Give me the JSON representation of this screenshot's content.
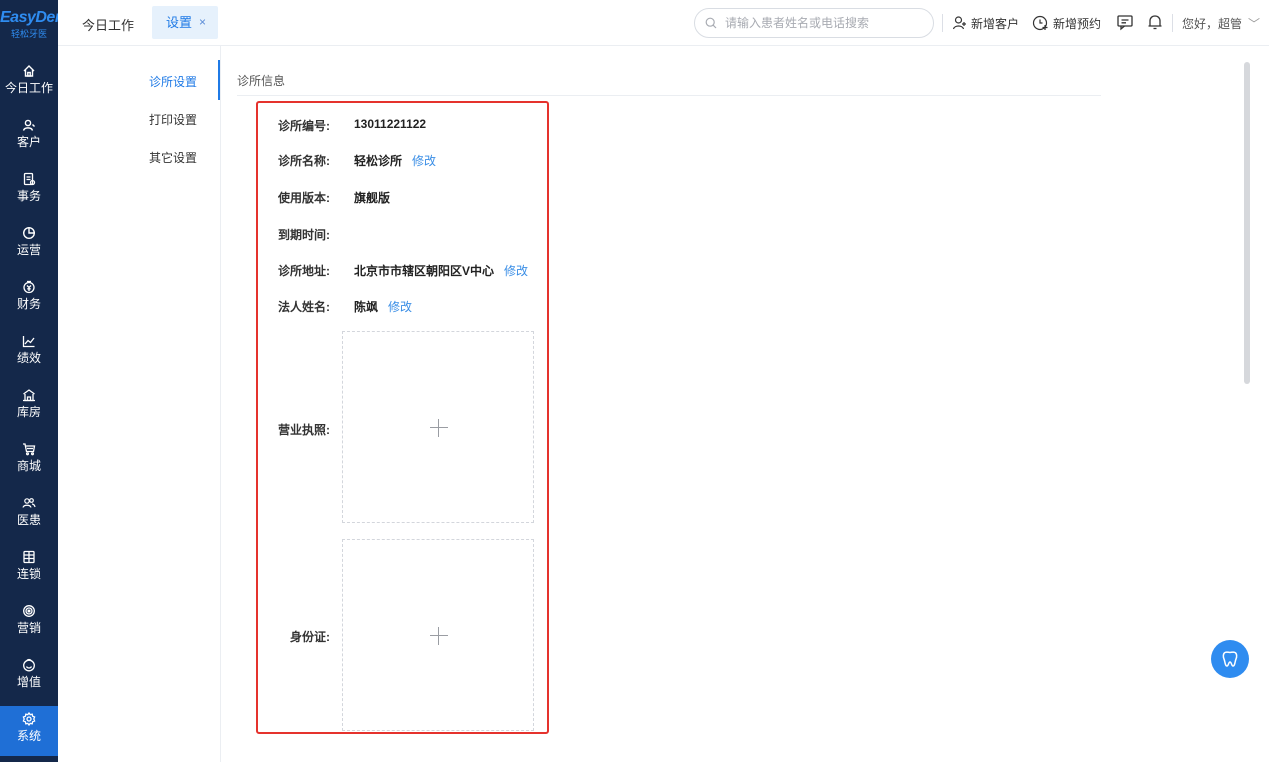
{
  "brand": {
    "name": "EasyDent",
    "subtitle": "轻松牙医"
  },
  "sidebar": {
    "items": [
      {
        "label": "今日工作",
        "icon": "home-icon"
      },
      {
        "label": "客户",
        "icon": "user-icon"
      },
      {
        "label": "事务",
        "icon": "task-icon"
      },
      {
        "label": "运营",
        "icon": "pie-icon"
      },
      {
        "label": "财务",
        "icon": "finance-icon"
      },
      {
        "label": "绩效",
        "icon": "chart-line-icon"
      },
      {
        "label": "库房",
        "icon": "warehouse-icon"
      },
      {
        "label": "商城",
        "icon": "cart-icon"
      },
      {
        "label": "医患",
        "icon": "users-icon"
      },
      {
        "label": "连锁",
        "icon": "store-icon"
      },
      {
        "label": "营销",
        "icon": "target-icon"
      },
      {
        "label": "增值",
        "icon": "tooth-icon"
      },
      {
        "label": "系统",
        "icon": "gear-icon",
        "active": true
      }
    ]
  },
  "header": {
    "tabs": [
      {
        "label": "今日工作"
      },
      {
        "label": "设置",
        "close": "×",
        "active": true
      }
    ],
    "search_placeholder": "请输入患者姓名或电话搜索",
    "new_customer": "新增客户",
    "new_appointment": "新增预约",
    "greeting": "您好，超管"
  },
  "subnav": {
    "items": [
      {
        "label": "诊所设置",
        "active": true
      },
      {
        "label": "打印设置"
      },
      {
        "label": "其它设置"
      }
    ]
  },
  "clinic": {
    "section_title": "诊所信息",
    "edit_label": "修改",
    "fields": {
      "code": {
        "label": "诊所编号:",
        "value": "13011221122"
      },
      "name": {
        "label": "诊所名称:",
        "value": "轻松诊所"
      },
      "version": {
        "label": "使用版本:",
        "value": "旗舰版"
      },
      "expiry": {
        "label": "到期时间:",
        "value": ""
      },
      "address": {
        "label": "诊所地址:",
        "value": "北京市市辖区朝阳区V中心"
      },
      "legal_person": {
        "label": "法人姓名:",
        "value": "陈飒"
      }
    },
    "license": {
      "label": "营业执照:"
    },
    "id_card": {
      "label": "身份证:"
    }
  },
  "colors": {
    "sidebar_bg": "#14284a",
    "accent": "#1f7ae6",
    "link": "#3a8ee6",
    "highlight_border": "#e5322d"
  }
}
